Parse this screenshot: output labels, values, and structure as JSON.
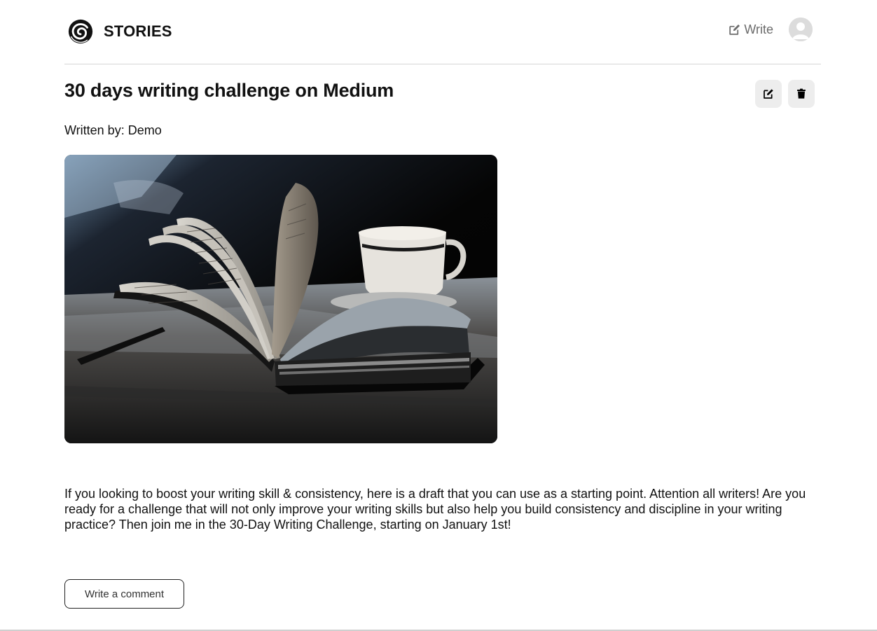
{
  "header": {
    "brand_title": "STORIES",
    "write_label": "Write",
    "logo_icon": "swirl-logo-icon",
    "write_icon": "pencil-square-icon",
    "avatar_icon": "user-avatar-icon"
  },
  "post": {
    "title": "30 days writing challenge on Medium",
    "author_line": "Written by: Demo",
    "cover_image_subject": "open-notebook-with-coffee-cup-photo",
    "body": "If you looking to boost your writing skill & consistency, here is a draft that you can use as a starting point. Attention all writers! Are you ready for a challenge that will not only improve your writing skills but also help you build consistency and discipline in your writing practice? Then join me in the 30-Day Writing Challenge, starting on January 1st!",
    "edit_icon": "edit-icon",
    "delete_icon": "trash-icon"
  },
  "comments": {
    "button_label": "Write a comment"
  },
  "colors": {
    "text": "#111111",
    "muted": "#6b6b6b",
    "action_bg": "#ededed",
    "divider": "#d6d6d6"
  }
}
